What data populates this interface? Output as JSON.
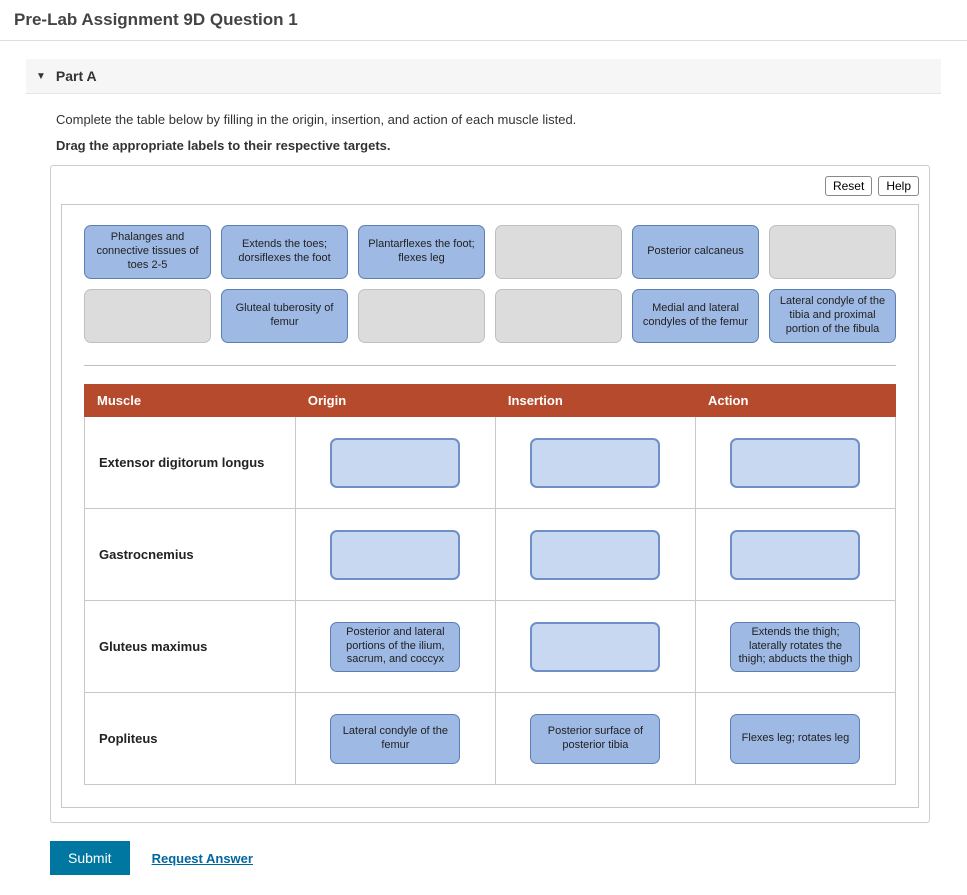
{
  "page": {
    "title": "Pre-Lab Assignment 9D Question 1"
  },
  "part": {
    "label": "Part A",
    "intro": "Complete the table below by filling in the origin, insertion, and action of each muscle listed.",
    "drag_hint": "Drag the appropriate labels to their respective targets."
  },
  "buttons": {
    "reset": "Reset",
    "help": "Help",
    "submit": "Submit",
    "request_answer": "Request Answer"
  },
  "bank": {
    "row1": [
      {
        "text": "Phalanges and connective tissues of toes 2-5",
        "filled": true
      },
      {
        "text": "Extends the toes; dorsiflexes the foot",
        "filled": true
      },
      {
        "text": "Plantarflexes the foot; flexes leg",
        "filled": true
      },
      {
        "text": "",
        "filled": false
      },
      {
        "text": "Posterior calcaneus",
        "filled": true
      },
      {
        "text": "",
        "filled": false
      }
    ],
    "row2": [
      {
        "text": "",
        "filled": false
      },
      {
        "text": "Gluteal tuberosity of femur",
        "filled": true
      },
      {
        "text": "",
        "filled": false
      },
      {
        "text": "",
        "filled": false
      },
      {
        "text": "Medial and lateral condyles of the femur",
        "filled": true
      },
      {
        "text": "Lateral condyle of the tibia and proximal portion of the fibula",
        "filled": true
      }
    ]
  },
  "table": {
    "headers": {
      "muscle": "Muscle",
      "origin": "Origin",
      "insertion": "Insertion",
      "action": "Action"
    },
    "rows": [
      {
        "muscle": "Extensor digitorum longus",
        "origin": {
          "text": "",
          "filled": false
        },
        "insertion": {
          "text": "",
          "filled": false
        },
        "action": {
          "text": "",
          "filled": false
        }
      },
      {
        "muscle": "Gastrocnemius",
        "origin": {
          "text": "",
          "filled": false
        },
        "insertion": {
          "text": "",
          "filled": false
        },
        "action": {
          "text": "",
          "filled": false
        }
      },
      {
        "muscle": "Gluteus maximus",
        "origin": {
          "text": "Posterior and lateral portions of the ilium, sacrum, and coccyx",
          "filled": true
        },
        "insertion": {
          "text": "",
          "filled": false
        },
        "action": {
          "text": "Extends the thigh; laterally rotates the thigh; abducts the thigh",
          "filled": true
        }
      },
      {
        "muscle": "Popliteus",
        "origin": {
          "text": "Lateral condyle of the femur",
          "filled": true
        },
        "insertion": {
          "text": "Posterior surface of posterior tibia",
          "filled": true
        },
        "action": {
          "text": "Flexes leg; rotates leg",
          "filled": true
        }
      }
    ]
  }
}
